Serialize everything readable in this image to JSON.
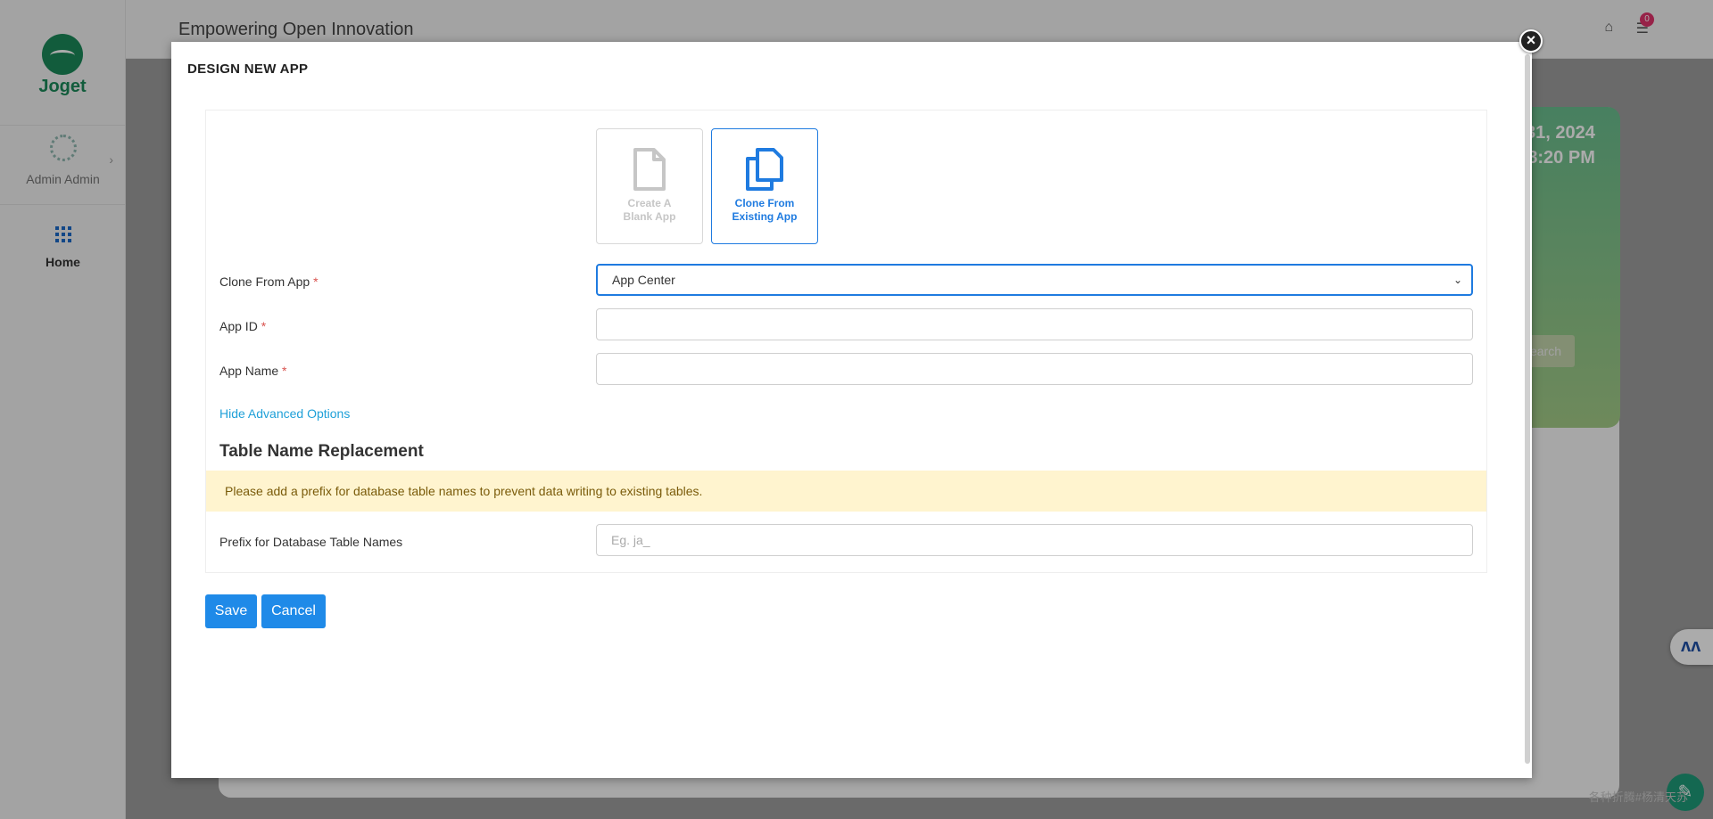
{
  "app": {
    "logo_text": "Joget",
    "header_title": "Empowering Open Innovation",
    "notification_count": "0"
  },
  "sidebar": {
    "user_name": "Admin Admin",
    "home_label": "Home"
  },
  "background": {
    "date_line1": "31, 2024",
    "date_line2": "8:20 PM",
    "search_partial": "earch",
    "watermark": "各种折腾#杨清天苏"
  },
  "modal": {
    "title": "DESIGN NEW APP",
    "close_glyph": "×",
    "options": [
      {
        "label_line1": "Create A",
        "label_line2": "Blank App",
        "selected": false
      },
      {
        "label_line1": "Clone From",
        "label_line2": "Existing App",
        "selected": true
      }
    ],
    "form": {
      "clone_from_label": "Clone From App",
      "clone_from_value": "App Center",
      "app_id_label": "App ID",
      "app_id_value": "",
      "app_name_label": "App Name",
      "app_name_value": "",
      "required_mark": "*"
    },
    "advanced_link": "Hide Advanced Options",
    "section_heading": "Table Name Replacement",
    "alert_text": "Please add a prefix for database table names to prevent data writing to existing tables.",
    "prefix_label": "Prefix for Database Table Names",
    "prefix_placeholder": "Eg. ja_",
    "save_label": "Save",
    "cancel_label": "Cancel"
  },
  "colors": {
    "primary": "#1f8ae8",
    "brand_green": "#1b8a5a",
    "alert_bg": "#fff4cf",
    "required": "#d9534f"
  },
  "icons": [
    "home-icon",
    "bell-icon",
    "user-icon",
    "grid-icon",
    "file-icon",
    "copy-icon",
    "close-icon",
    "edit-icon"
  ]
}
